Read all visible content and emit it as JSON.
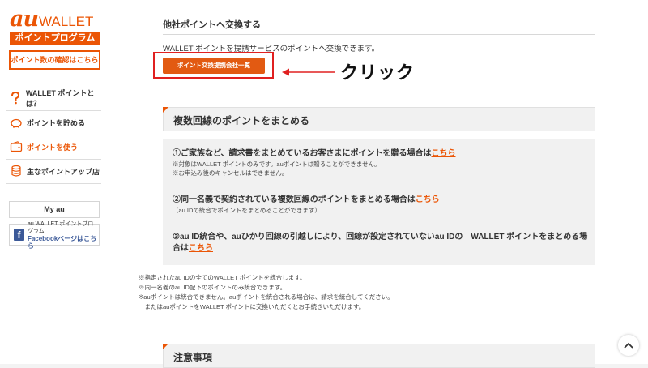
{
  "sidebar": {
    "logo": {
      "au": "au",
      "wallet": "WALLET",
      "program": "ポイントプログラム"
    },
    "check_points_button": "ポイント数の確認はこちら",
    "nav": [
      {
        "label": "WALLET ポイントとは？",
        "icon": "question-icon"
      },
      {
        "label": "ポイントを貯める",
        "icon": "piggy-bank-icon"
      },
      {
        "label": "ポイントを使う",
        "icon": "wallet-icon"
      },
      {
        "label": "主なポイントアップ店",
        "icon": "coins-icon"
      }
    ],
    "myau": "My au",
    "facebook": {
      "line1": "au WALLET ポイントプログラム",
      "line2": "Facebookページはこちら"
    }
  },
  "exchange": {
    "title": "他社ポイントへ交換する",
    "desc": "WALLET ポイントを提携サービスのポイントへ交換できます。",
    "button": "ポイント交換提携会社一覧",
    "annotation": "クリック"
  },
  "combine": {
    "title": "複数回線のポイントをまとめる",
    "items": [
      {
        "lead": "①ご家族など、請求書をまとめているお客さまにポイントを贈る場合は",
        "link": "こちら",
        "subs": [
          "※対象はWALLET ポイントのみです。auポイントは贈ることができません。",
          "※お申込み後のキャンセルはできません。"
        ]
      },
      {
        "lead": "②同一名義で契約されている複数回線のポイントをまとめる場合は",
        "link": "こちら",
        "subs": [
          "（au IDの統合でポイントをまとめることができます）"
        ]
      },
      {
        "lead": "③au ID統合や、auひかり回線の引越しにより、回線が設定されていないau IDの　WALLET ポイントをまとめる場合は",
        "link": "こちら",
        "subs": []
      }
    ],
    "notes": [
      "※指定されたau IDの全てのWALLET ポイントを統合します。",
      "※同一名義のau ID配下のポイントのみ統合できます。",
      "※auポイントは統合できません。auポイントを統合される場合は、請求を統合してください。",
      "　またはauポイントをWALLET ポイントに交換いただくとお手続きいただけます。"
    ]
  },
  "caution": {
    "title": "注意事項"
  },
  "colors": {
    "accent": "#eb5505",
    "highlight": "#e02020"
  }
}
